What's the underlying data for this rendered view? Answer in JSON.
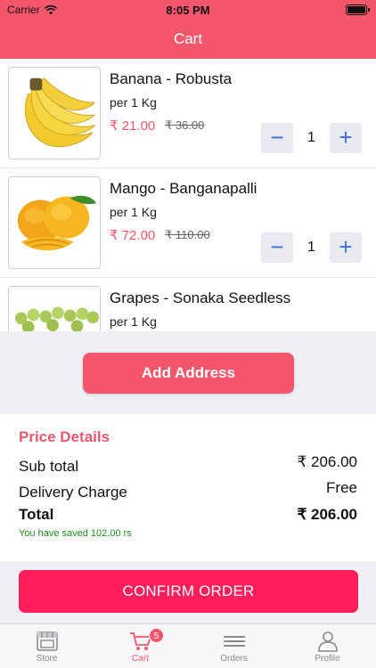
{
  "status_bar": {
    "carrier": "Carrier",
    "time": "8:05 PM"
  },
  "header": {
    "title": "Cart"
  },
  "cart": {
    "items": [
      {
        "name": "Banana - Robusta",
        "unit": "per 1 Kg",
        "price": "₹ 21.00",
        "mrp": "₹ 36.00",
        "qty": "1",
        "image_icon": "banana-image"
      },
      {
        "name": "Mango - Banganapalli",
        "unit": "per 1 Kg",
        "price": "₹ 72.00",
        "mrp": "₹ 110.00",
        "qty": "1",
        "image_icon": "mango-image"
      },
      {
        "name": "Grapes - Sonaka Seedless",
        "unit": "per 1 Kg",
        "price": "",
        "mrp": "",
        "qty": "",
        "image_icon": "grapes-image"
      }
    ],
    "minus_glyph": "−",
    "plus_glyph": "+"
  },
  "address": {
    "button_label": "Add Address"
  },
  "price_details": {
    "title": "Price Details",
    "subtotal_label": "Sub total",
    "subtotal_value": "₹ 206.00",
    "delivery_label": "Delivery Charge",
    "delivery_value": "Free",
    "total_label": "Total",
    "total_value": "₹ 206.00",
    "saved_text": "You have saved 102.00 rs"
  },
  "confirm": {
    "button_label": "CONFIRM ORDER"
  },
  "tabbar": {
    "tabs": [
      {
        "label": "Store",
        "icon": "store-icon"
      },
      {
        "label": "Cart",
        "icon": "cart-icon",
        "badge": "5",
        "active": true
      },
      {
        "label": "Orders",
        "icon": "orders-icon"
      },
      {
        "label": "Profile",
        "icon": "profile-icon"
      }
    ]
  },
  "colors": {
    "primary": "#f4576c",
    "confirm": "#ff1f5a",
    "saved_text": "#1e8a1e",
    "stepper_icon": "#3d6fd4"
  }
}
